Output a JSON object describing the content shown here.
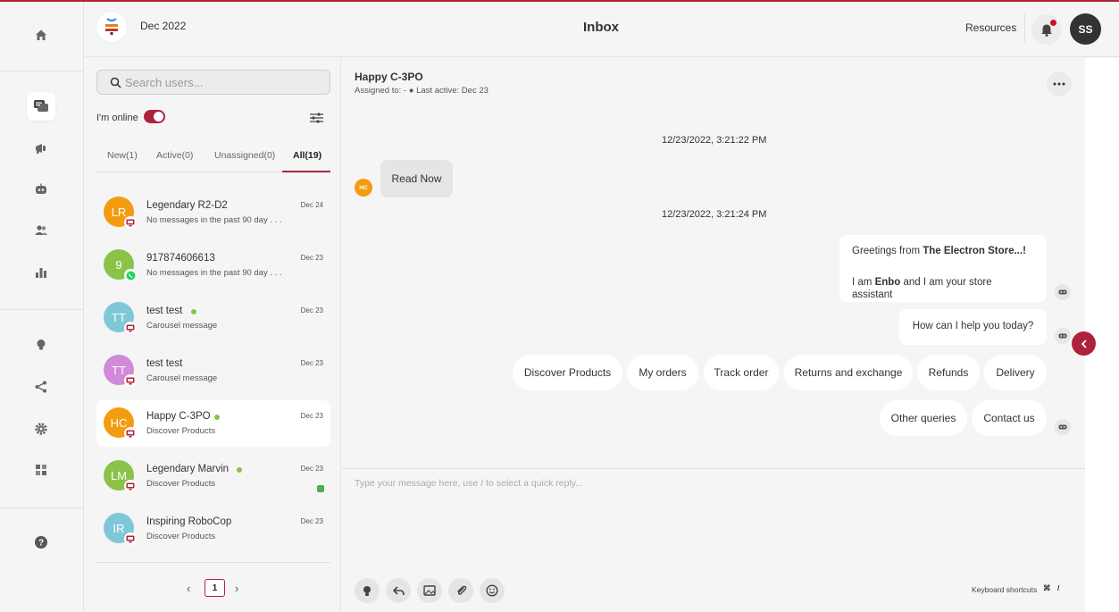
{
  "header": {
    "brand_date": "Dec 2022",
    "title": "Inbox",
    "resources": "Resources",
    "avatar": "SS"
  },
  "search": {
    "placeholder": "Search users..."
  },
  "status": {
    "online_label": "I'm online",
    "online": true
  },
  "tabs": [
    {
      "label": "New(1)"
    },
    {
      "label": "Active(0)"
    },
    {
      "label": "Unassigned(0)"
    },
    {
      "label": "All(19)"
    }
  ],
  "users": [
    {
      "initials": "LR",
      "name": "Legendary R2-D2",
      "sub": "No messages in the past 90 day . . .",
      "date": "Dec 24",
      "color": "#f39c12",
      "channel": "web",
      "online": false
    },
    {
      "initials": "9",
      "name": "917874606613",
      "sub": "No messages in the past 90 day . . .",
      "date": "Dec 23",
      "color": "#8bc34a",
      "channel": "whatsapp",
      "online": false
    },
    {
      "initials": "TT",
      "name": "test test",
      "sub": "Carousel message",
      "date": "Dec 23",
      "color": "#7ec8d8",
      "channel": "web",
      "online": true
    },
    {
      "initials": "TT",
      "name": "test test",
      "sub": "Carousel message",
      "date": "Dec 23",
      "color": "#d18ad8",
      "channel": "web",
      "online": false
    },
    {
      "initials": "HC",
      "name": "Happy C-3PO",
      "sub": "Discover Products",
      "date": "Dec 23",
      "color": "#f39c12",
      "channel": "web",
      "online": true
    },
    {
      "initials": "LM",
      "name": "Legendary Marvin",
      "sub": "Discover Products",
      "date": "Dec 23",
      "color": "#8bc34a",
      "channel": "web",
      "online": true
    },
    {
      "initials": "IR",
      "name": "Inspiring RoboCop",
      "sub": "Discover Products",
      "date": "Dec 23",
      "color": "#7ec8d8",
      "channel": "web",
      "online": false
    }
  ],
  "pager": {
    "page": "1"
  },
  "chat": {
    "name": "Happy C-3PO",
    "meta": "Assigned to: - ● Last active: Dec 23",
    "ts1": "12/23/2022, 3:21:22 PM",
    "incoming": "Read Now",
    "incoming_avatar": "HC",
    "ts2": "12/23/2022, 3:21:24 PM",
    "greeting_prefix": "Greetings from ",
    "greeting_store": "The Electron Store...!",
    "intro_prefix": "I am ",
    "intro_name": "Enbo",
    "intro_suffix": " and I am your store assistant",
    "question": "How can I help you today?",
    "quick_replies_row1": [
      "Discover Products",
      "My orders",
      "Track order",
      "Returns and exchange",
      "Refunds",
      "Delivery"
    ],
    "quick_replies_row2": [
      "Other queries",
      "Contact us"
    ],
    "composer_placeholder": "Type your message here, use / to select a quick reply...",
    "keyboard_label": "Keyboard shortcuts",
    "key1": "⌘",
    "key2": "/"
  },
  "colors": {
    "accent": "#b0213c",
    "online": "#8bc34a"
  }
}
